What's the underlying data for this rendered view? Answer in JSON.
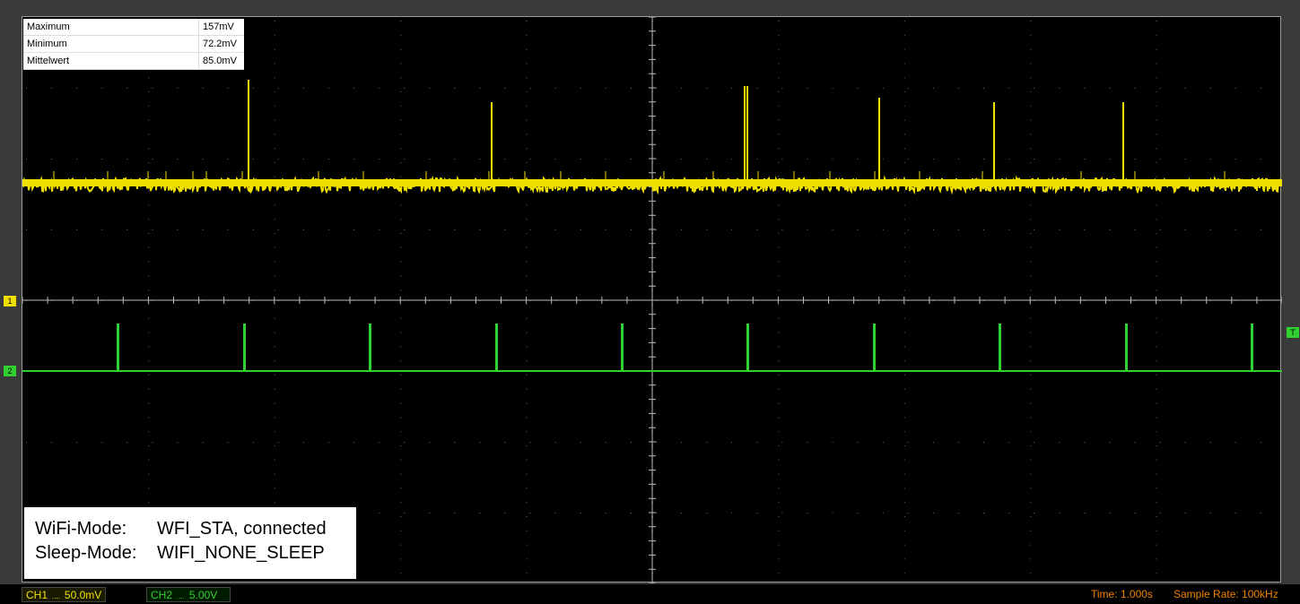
{
  "measurements": [
    {
      "label": "Maximum",
      "value": "157mV"
    },
    {
      "label": "Minimum",
      "value": "72.2mV"
    },
    {
      "label": "Mittelwert",
      "value": "85.0mV"
    }
  ],
  "note": {
    "line1_key": "WiFi-Mode:",
    "line1_val": "WFI_STA, connected",
    "line2_key": "Sleep-Mode:",
    "line2_val": "WIFI_NONE_SLEEP"
  },
  "status": {
    "ch1_label": "CH1",
    "ch1_dots": "....",
    "ch1_scale": "50.0mV",
    "ch2_label": "CH2",
    "ch2_dots": "....",
    "ch2_scale": "5.00V",
    "time": "Time: 1.000s",
    "sample_rate": "Sample Rate: 100kHz"
  },
  "markers": {
    "ch1": "1",
    "ch2": "2",
    "trigger": "T"
  },
  "colors": {
    "ch1": "#f0e000",
    "ch2": "#30d030",
    "grid": "#7a7a7a",
    "background": "#000000"
  }
}
